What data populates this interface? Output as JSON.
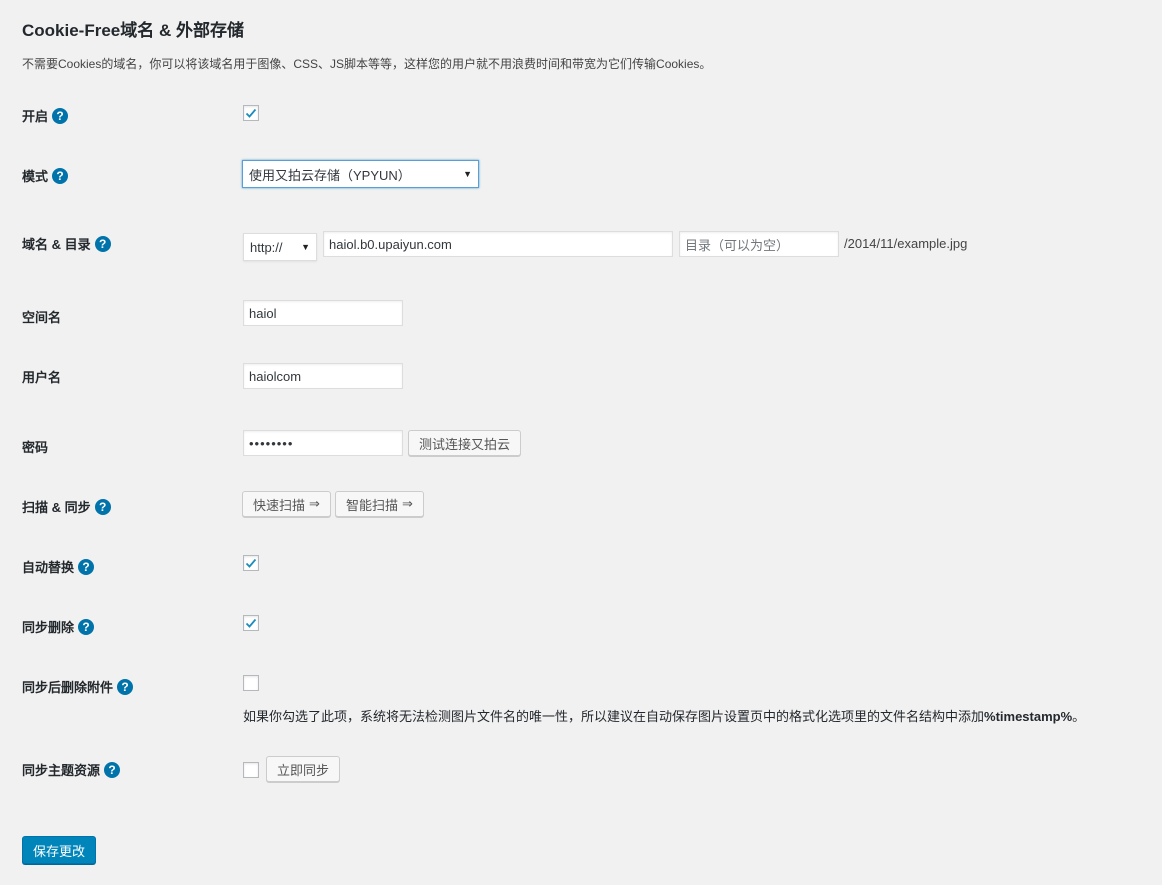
{
  "page": {
    "title": "Cookie-Free域名 & 外部存储",
    "description": "不需要Cookies的域名，你可以将该域名用于图像、CSS、JS脚本等等，这样您的用户就不用浪费时间和带宽为它们传输Cookies。"
  },
  "icons": {
    "help": "question-circle-icon",
    "check": "checkmark-icon",
    "arrow": "arrow-right-icon"
  },
  "help_glyph": "?",
  "colors": {
    "primary": "#0085ba",
    "help": "#0073aa",
    "background": "#f1f1f1"
  },
  "rows": {
    "enable": {
      "label": "开启",
      "checked": true
    },
    "mode": {
      "label": "模式",
      "selected": "使用又拍云存储（YPYUN）"
    },
    "domain": {
      "label": "域名 & 目录",
      "protocol": "http://",
      "host": "haiol.b0.upaiyun.com",
      "dir_placeholder": "目录（可以为空）",
      "suffix": "/2014/11/example.jpg"
    },
    "bucket": {
      "label": "空间名",
      "value": "haiol"
    },
    "username": {
      "label": "用户名",
      "value": "haiolcom"
    },
    "password": {
      "label": "密码",
      "value": "••••••••",
      "test_button": "测试连接又拍云"
    },
    "scan": {
      "label": "扫描 & 同步",
      "quick_button": "快速扫描",
      "smart_button": "智能扫描",
      "arrow_glyph": "⇒"
    },
    "auto_replace": {
      "label": "自动替换",
      "checked": true
    },
    "sync_delete": {
      "label": "同步删除",
      "checked": true
    },
    "delete_after_sync": {
      "label": "同步后删除附件",
      "checked": false,
      "note_prefix": "如果你勾选了此项，系统将无法检测图片文件名的唯一性，所以建议在自动保存图片设置页中的格式化选项里的文件名结构中添加",
      "note_token": "%timestamp%",
      "note_suffix": "。"
    },
    "sync_theme": {
      "label": "同步主题资源",
      "checked": false,
      "sync_button": "立即同步"
    }
  },
  "save_button": "保存更改"
}
